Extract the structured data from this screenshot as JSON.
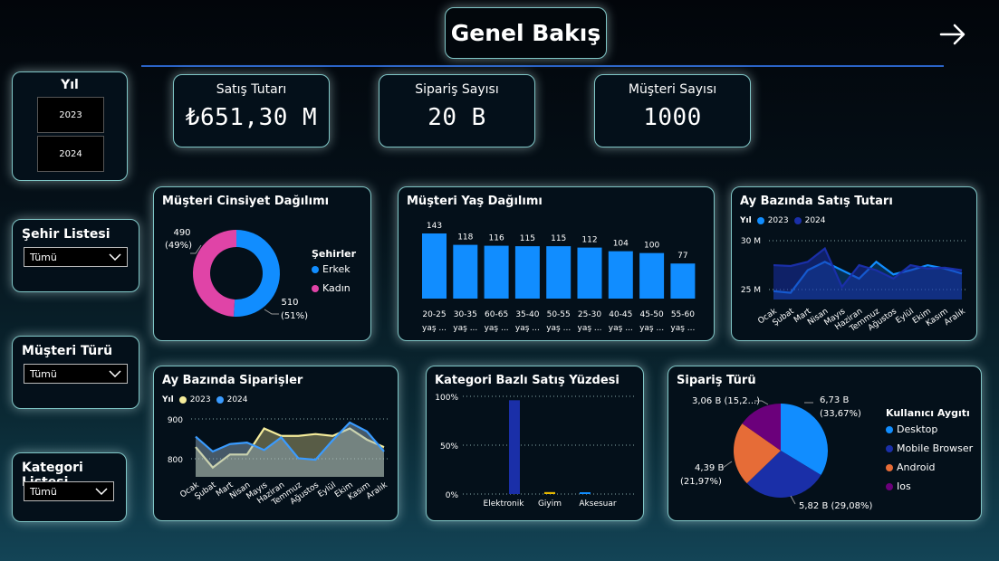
{
  "header": {
    "title": "Genel Bakış"
  },
  "kpis": {
    "sales": {
      "label": "Satış Tutarı",
      "value": "₺651,30 M"
    },
    "orders": {
      "label": "Sipariş Sayısı",
      "value": "20 B"
    },
    "customers": {
      "label": "Müşteri Sayısı",
      "value": "1000"
    }
  },
  "filters": {
    "year": {
      "title": "Yıl",
      "options": [
        "2023",
        "2024"
      ]
    },
    "city": {
      "title": "Şehir Listesi",
      "value": "Tümü"
    },
    "customer_type": {
      "title": "Müşteri Türü",
      "value": "Tümü"
    },
    "category": {
      "title": "Kategori Listesi",
      "value": "Tümü"
    }
  },
  "gender_chart": {
    "title": "Müşteri Cinsiyet Dağılımı",
    "legend_title": "Şehirler",
    "labels": {
      "female": [
        "490",
        "(49%)"
      ],
      "male": [
        "510",
        "(51%)"
      ]
    },
    "colors": {
      "Erkek": "#118dff",
      "Kadın": "#e044a7"
    }
  },
  "age_chart": {
    "title": "Müşteri Yaş Dağılımı",
    "color": "#118dff"
  },
  "monthly_sales": {
    "title": "Ay Bazında Satış Tutarı",
    "legend_title": "Yıl",
    "y_ticks": [
      "30 M",
      "25 M"
    ],
    "colors": {
      "2023": "#118dff",
      "2024": "#1a2fa8"
    }
  },
  "monthly_orders": {
    "title": "Ay Bazında Siparişler",
    "legend_title": "Yıl",
    "y_ticks": [
      "900",
      "800"
    ],
    "colors": {
      "2023": "#f5ec9b",
      "2024": "#3a9bff"
    }
  },
  "category_chart": {
    "title": "Kategori Bazlı Satış Yüzdesi",
    "y_ticks": [
      "100%",
      "50%",
      "0%"
    ],
    "colors": {
      "Elektronik": "#1a2fa8",
      "Giyim": "#e6b800",
      "Aksesuar": "#118dff"
    }
  },
  "order_type": {
    "title": "Sipariş Türü",
    "legend_title": "Kullanıcı Aygıtı",
    "slice_labels": {
      "Desktop": [
        "6,73 B",
        "(33,67%)"
      ],
      "Mobile Browser": [
        "5,82 B (29,08%)"
      ],
      "Android": [
        "4,39 B",
        "(21,97%)"
      ],
      "Ios": [
        "3,06 B (15,2...)"
      ]
    },
    "colors": {
      "Desktop": "#118dff",
      "Mobile Browser": "#1a2fa8",
      "Android": "#e66c37",
      "Ios": "#6b007b"
    }
  },
  "chart_data": [
    {
      "type": "pie",
      "title": "Müşteri Cinsiyet Dağılımı",
      "categories": [
        "Erkek",
        "Kadın"
      ],
      "values": [
        510,
        490
      ]
    },
    {
      "type": "bar",
      "title": "Müşteri Yaş Dağılımı",
      "categories": [
        [
          "20-25",
          "yaş ..."
        ],
        [
          "30-35",
          "yaş ..."
        ],
        [
          "60-65",
          "yaş ..."
        ],
        [
          "35-40",
          "yaş ..."
        ],
        [
          "50-55",
          "yaş ..."
        ],
        [
          "25-30",
          "yaş ..."
        ],
        [
          "40-45",
          "yaş ..."
        ],
        [
          "45-50",
          "yaş ..."
        ],
        [
          "55-60",
          "yaş ..."
        ]
      ],
      "values": [
        143,
        118,
        116,
        115,
        115,
        112,
        104,
        100,
        77
      ]
    },
    {
      "type": "area",
      "title": "Ay Bazında Satış Tutarı",
      "categories": [
        "Ocak",
        "Şubat",
        "Mart",
        "Nisan",
        "Mayıs",
        "Haziran",
        "Temmuz",
        "Ağustos",
        "Eylül",
        "Ekim",
        "Kasım",
        "Aralık"
      ],
      "series": [
        {
          "name": "2023",
          "values": [
            24.5,
            24.3,
            27.0,
            28.0,
            27.0,
            26.0,
            28.0,
            26.5,
            27.0,
            27.6,
            27.2,
            26.6
          ]
        },
        {
          "name": "2024",
          "values": [
            27.6,
            27.5,
            28.0,
            29.6,
            25.0,
            27.6,
            27.0,
            26.0,
            27.6,
            27.2,
            27.3,
            27.0
          ]
        }
      ],
      "ylim": [
        23.5,
        31.5
      ]
    },
    {
      "type": "area",
      "title": "Ay Bazında Siparişler",
      "categories": [
        "Ocak",
        "Şubat",
        "Mart",
        "Nisan",
        "Mayıs",
        "Haziran",
        "Temmuz",
        "Ağustos",
        "Eylül",
        "Ekim",
        "Kasım",
        "Aralık"
      ],
      "series": [
        {
          "name": "2023",
          "values": [
            830,
            775,
            810,
            810,
            880,
            860,
            860,
            865,
            860,
            880,
            850,
            830
          ]
        },
        {
          "name": "2024",
          "values": [
            858,
            818,
            838,
            842,
            822,
            856,
            800,
            796,
            848,
            896,
            872,
            818
          ]
        }
      ],
      "ylim": [
        750,
        925
      ]
    },
    {
      "type": "bar",
      "title": "Kategori Bazlı Satış Yüzdesi",
      "categories": [
        "Elektronik",
        "Giyim",
        "Aksesuar"
      ],
      "values": [
        96,
        2,
        1
      ],
      "ylim": [
        0,
        100
      ]
    },
    {
      "type": "pie",
      "title": "Sipariş Türü",
      "categories": [
        "Desktop",
        "Mobile Browser",
        "Android",
        "Ios"
      ],
      "values": [
        33.67,
        29.08,
        21.97,
        15.28
      ]
    }
  ]
}
